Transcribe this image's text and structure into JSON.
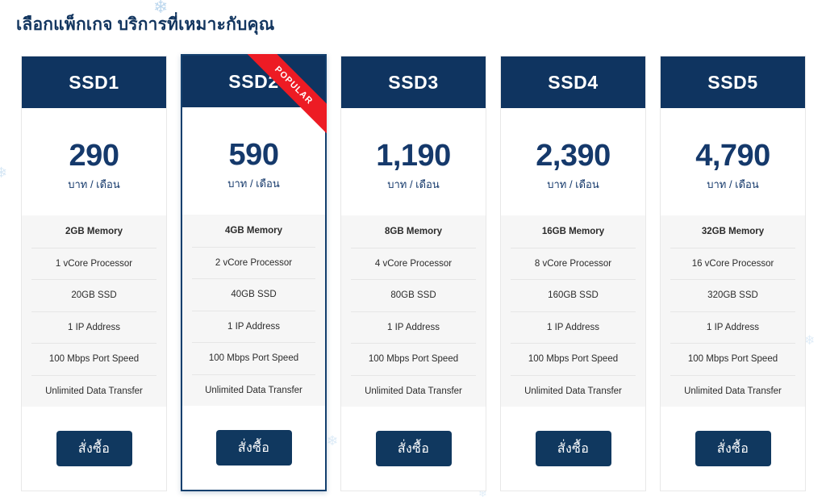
{
  "page": {
    "heading": "เลือกแพ็กเกจ บริการที่เหมาะกับคุณ",
    "accent_navy": "#0f3460",
    "price_navy": "#15396b",
    "ribbon_red": "#ed1b24",
    "feature_bg": "#f6f6f6"
  },
  "decor": {
    "snowflake_glyph": "❄"
  },
  "plans": [
    {
      "name": "SSD1",
      "price": "290",
      "price_unit": "บาท / เดือน",
      "badge": null,
      "featured": false,
      "features": [
        "2GB Memory",
        "1 vCore Processor",
        "20GB SSD",
        "1 IP Address",
        "100 Mbps Port Speed",
        "Unlimited Data Transfer"
      ],
      "cta_label": "สั่งซื้อ"
    },
    {
      "name": "SSD2",
      "price": "590",
      "price_unit": "บาท / เดือน",
      "badge": "POPULAR",
      "featured": true,
      "features": [
        "4GB Memory",
        "2 vCore Processor",
        "40GB SSD",
        "1 IP Address",
        "100 Mbps Port Speed",
        "Unlimited Data Transfer"
      ],
      "cta_label": "สั่งซื้อ"
    },
    {
      "name": "SSD3",
      "price": "1,190",
      "price_unit": "บาท / เดือน",
      "badge": null,
      "featured": false,
      "features": [
        "8GB Memory",
        "4 vCore Processor",
        "80GB SSD",
        "1 IP Address",
        "100 Mbps Port Speed",
        "Unlimited Data Transfer"
      ],
      "cta_label": "สั่งซื้อ"
    },
    {
      "name": "SSD4",
      "price": "2,390",
      "price_unit": "บาท / เดือน",
      "badge": null,
      "featured": false,
      "features": [
        "16GB Memory",
        "8 vCore Processor",
        "160GB SSD",
        "1 IP Address",
        "100 Mbps Port Speed",
        "Unlimited Data Transfer"
      ],
      "cta_label": "สั่งซื้อ"
    },
    {
      "name": "SSD5",
      "price": "4,790",
      "price_unit": "บาท / เดือน",
      "badge": null,
      "featured": false,
      "features": [
        "32GB Memory",
        "16 vCore Processor",
        "320GB SSD",
        "1 IP Address",
        "100 Mbps Port Speed",
        "Unlimited Data Transfer"
      ],
      "cta_label": "สั่งซื้อ"
    }
  ]
}
